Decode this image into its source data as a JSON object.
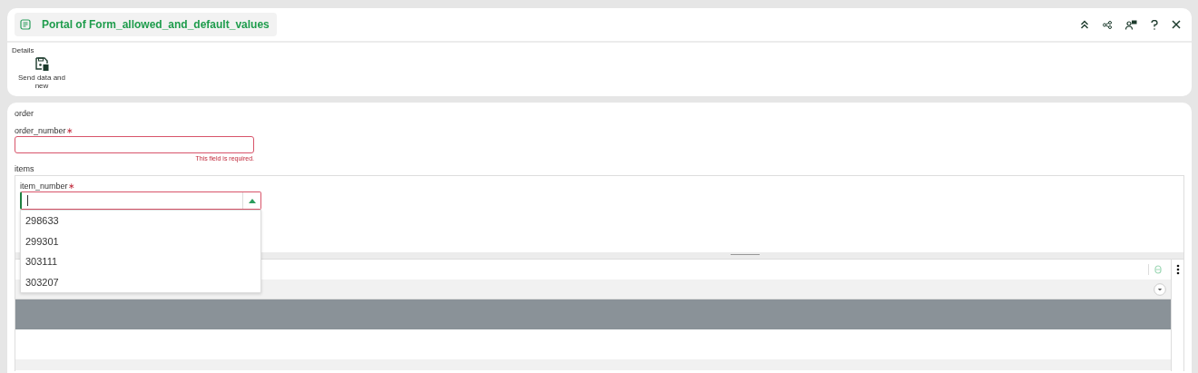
{
  "window": {
    "title": "Portal of Form_allowed_and_default_values"
  },
  "toolbar": {
    "group": "Details",
    "buttons": [
      {
        "label": "Send data and new"
      }
    ]
  },
  "form": {
    "section": "order",
    "order_number": {
      "label": "order_number",
      "required": true,
      "error": "This field is required."
    },
    "items": {
      "label": "items",
      "item_number": {
        "label": "item_number",
        "required": true,
        "expanded": true,
        "focused": true,
        "options": [
          "298633",
          "299301",
          "303111",
          "303207"
        ]
      },
      "grid": {
        "rows": [
          {
            "selected": true
          }
        ]
      }
    }
  },
  "required_marker": "∗"
}
